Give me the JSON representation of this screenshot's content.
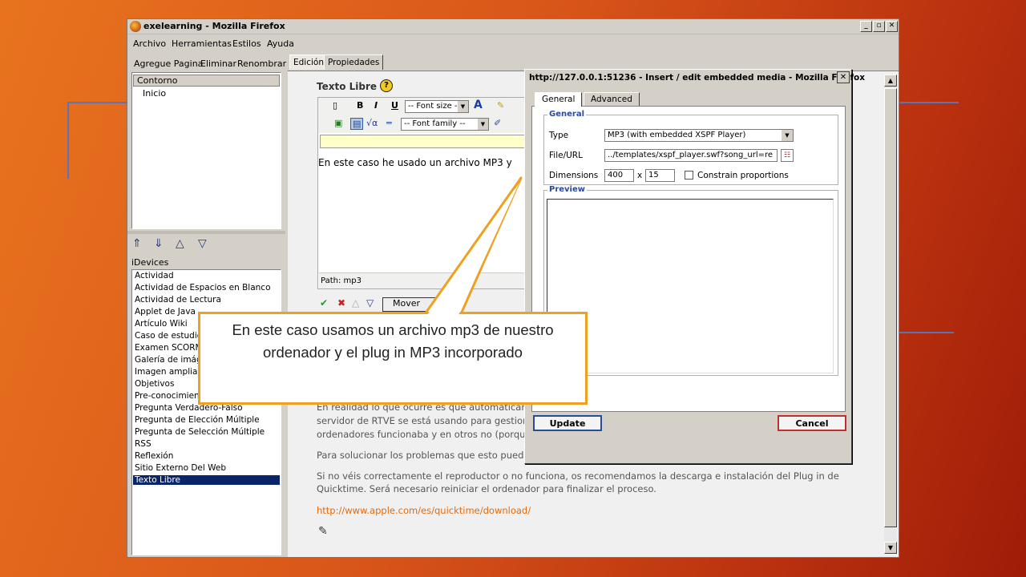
{
  "window": {
    "title": "exelearning - Mozilla Firefox",
    "controls": [
      "_",
      "▫",
      "✕"
    ]
  },
  "menu": [
    "Archivo",
    "Herramientas",
    "Estilos",
    "Ayuda"
  ],
  "left_pane": {
    "buttons": [
      "Agregue Pagina",
      "Eliminar",
      "Renombrar"
    ],
    "tree_header": "Contorno",
    "tree_item": "Inicio",
    "idevices_label": "iDevices",
    "idevices": [
      "Actividad",
      "Actividad de Espacios en Blanco",
      "Actividad de Lectura",
      "Applet de Java",
      "Artículo Wiki",
      "Caso de estudio",
      "Examen SCORM",
      "Galería de imágenes",
      "Imagen ampliada",
      "Objetivos",
      "Pre-conocimiento",
      "Pregunta Verdadero-Falso",
      "Pregunta de Elección Múltiple",
      "Pregunta de Selección Múltiple",
      "RSS",
      "Reflexión",
      "Sitio Externo Del Web",
      "Texto Libre"
    ]
  },
  "right_pane": {
    "tabs": [
      "Edición",
      "Propiedades"
    ],
    "editor_title": "Texto Libre",
    "font_size": "-- Font size --",
    "font_family": "-- Font family --",
    "editor_text": "En este caso he usado un archivo MP3 y",
    "path_label": "Path: mp3",
    "move_label": "Mover",
    "para1_line1": "En realidad lo que ocurre es que automáticamente",
    "para1_line2": "servidor de RTVE se está usando para gestiona",
    "para1_line3": "ordenadores funcionaba y en otros no (porque e",
    "para2": "Para solucionar los problemas que esto pueda c",
    "para3_line1": "Si no véis correctamente el reproductor o no funciona, os recomendamos la descarga e instalación del Plug in de",
    "para3_line2": "Quicktime. Será necesario reiniciar el ordenador para finalizar el proceso.",
    "link": "http://www.apple.com/es/quicktime/download/"
  },
  "dialog": {
    "title": "http://127.0.0.1:51236 - Insert / edit embedded media - Mozilla Firefox",
    "tabs": [
      "General",
      "Advanced"
    ],
    "general_legend": "General",
    "type_label": "Type",
    "type_value": "MP3 (with embedded XSPF Player)",
    "file_label": "File/URL",
    "file_value": "../templates/xspf_player.swf?song_url=re",
    "dimensions_label": "Dimensions",
    "width": "400",
    "x": "x",
    "height": "15",
    "constrain_label": "Constrain proportions",
    "preview_legend": "Preview",
    "update": "Update",
    "cancel": "Cancel"
  },
  "callout": {
    "text": "En este caso usamos un archivo mp3 de nuestro ordenador y el plug in MP3 incorporado",
    "border_color": "#f0a020"
  }
}
